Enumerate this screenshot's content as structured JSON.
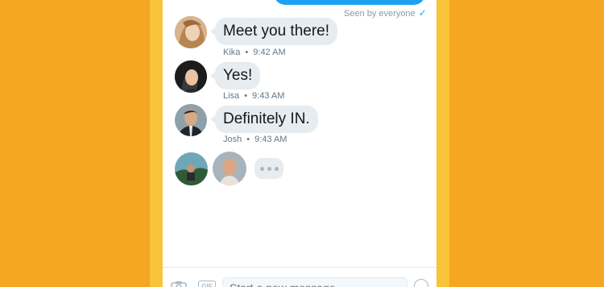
{
  "colors": {
    "background": "#F5A623",
    "bezel": "#F8C53A",
    "accent": "#1DA1F2",
    "bubble": "#E6ECF0"
  },
  "thread": {
    "seen_status": "Seen by everyone",
    "seen_icon": "checkmark-icon",
    "messages": [
      {
        "text": "Meet you there!",
        "sender": "Kika",
        "time": "9:42 AM"
      },
      {
        "text": "Yes!",
        "sender": "Lisa",
        "time": "9:43 AM"
      },
      {
        "text": "Definitely IN.",
        "sender": "Josh",
        "time": "9:43 AM"
      }
    ],
    "meta_separator": "•"
  },
  "composer": {
    "camera_icon": "camera-icon",
    "gif_label": "GIF",
    "placeholder": "Start a new message",
    "emoji_icon": "emoji-icon"
  }
}
